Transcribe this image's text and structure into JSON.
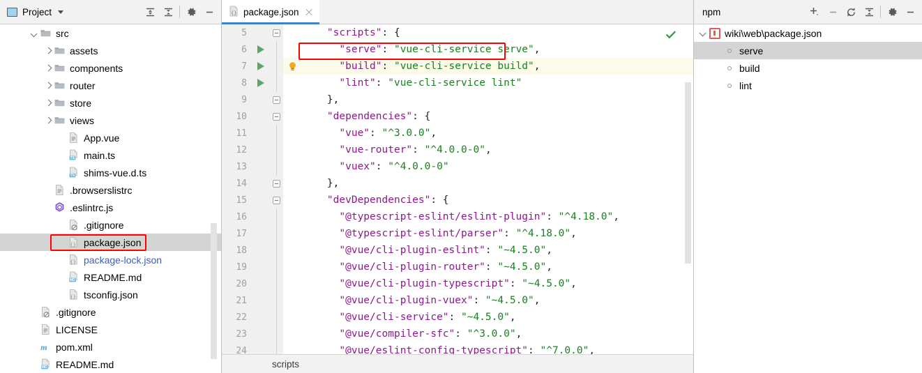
{
  "project_panel": {
    "title": "Project",
    "toolbar": [
      {
        "name": "expand-all-icon",
        "label": "Expand All"
      },
      {
        "name": "collapse-all-icon",
        "label": "Collapse All"
      },
      {
        "name": "gear-icon",
        "label": "Settings"
      },
      {
        "name": "minimize-icon",
        "label": "Hide"
      }
    ],
    "tree": [
      {
        "label": "src",
        "indent": 2,
        "arrow": "down",
        "icon": "folder",
        "selected": false,
        "link": false
      },
      {
        "label": "assets",
        "indent": 3,
        "arrow": "right",
        "icon": "folder",
        "selected": false,
        "link": false
      },
      {
        "label": "components",
        "indent": 3,
        "arrow": "right",
        "icon": "folder",
        "selected": false,
        "link": false
      },
      {
        "label": "router",
        "indent": 3,
        "arrow": "right",
        "icon": "folder",
        "selected": false,
        "link": false
      },
      {
        "label": "store",
        "indent": 3,
        "arrow": "right",
        "icon": "folder",
        "selected": false,
        "link": false
      },
      {
        "label": "views",
        "indent": 3,
        "arrow": "right",
        "icon": "folder",
        "selected": false,
        "link": false
      },
      {
        "label": "App.vue",
        "indent": 4,
        "arrow": "none",
        "icon": "file",
        "selected": false,
        "link": false
      },
      {
        "label": "main.ts",
        "indent": 4,
        "arrow": "none",
        "icon": "file-ts",
        "selected": false,
        "link": false
      },
      {
        "label": "shims-vue.d.ts",
        "indent": 4,
        "arrow": "none",
        "icon": "file-ts",
        "selected": false,
        "link": false
      },
      {
        "label": ".browserslistrc",
        "indent": 3,
        "arrow": "none",
        "icon": "file",
        "selected": false,
        "link": false
      },
      {
        "label": ".eslintrc.js",
        "indent": 3,
        "arrow": "none",
        "icon": "eslint",
        "selected": false,
        "link": false
      },
      {
        "label": ".gitignore",
        "indent": 4,
        "arrow": "none",
        "icon": "file-git",
        "selected": false,
        "link": false
      },
      {
        "label": "package.json",
        "indent": 4,
        "arrow": "none",
        "icon": "file-json",
        "selected": true,
        "link": false
      },
      {
        "label": "package-lock.json",
        "indent": 4,
        "arrow": "none",
        "icon": "file-json",
        "selected": false,
        "link": true
      },
      {
        "label": "README.md",
        "indent": 4,
        "arrow": "none",
        "icon": "file-md",
        "selected": false,
        "link": false
      },
      {
        "label": "tsconfig.json",
        "indent": 4,
        "arrow": "none",
        "icon": "file-json",
        "selected": false,
        "link": false
      },
      {
        "label": ".gitignore",
        "indent": 2,
        "arrow": "none",
        "icon": "file-git",
        "selected": false,
        "link": false
      },
      {
        "label": "LICENSE",
        "indent": 2,
        "arrow": "none",
        "icon": "file",
        "selected": false,
        "link": false
      },
      {
        "label": "pom.xml",
        "indent": 2,
        "arrow": "none",
        "icon": "maven",
        "selected": false,
        "link": false
      },
      {
        "label": "README.md",
        "indent": 2,
        "arrow": "none",
        "icon": "file-md",
        "selected": false,
        "link": false
      }
    ],
    "highlight_row_index": 12
  },
  "editor": {
    "tab": {
      "label": "package.json",
      "icon": "json-file-icon",
      "active": true
    },
    "breadcrumb": "scripts",
    "status_icon": "inspection-ok-check",
    "lines": [
      {
        "num": "5",
        "fold": "minus",
        "run": false,
        "bulb": false,
        "caret": false,
        "tokens": [
          {
            "t": "    ",
            "c": "p"
          },
          {
            "t": "\"scripts\"",
            "c": "k"
          },
          {
            "t": ": {",
            "c": "p"
          }
        ]
      },
      {
        "num": "6",
        "fold": "line",
        "run": true,
        "bulb": false,
        "caret": false,
        "tokens": [
          {
            "t": "      ",
            "c": "p"
          },
          {
            "t": "\"serve\"",
            "c": "k"
          },
          {
            "t": ": ",
            "c": "p"
          },
          {
            "t": "\"vue-cli-service serve\"",
            "c": "s"
          },
          {
            "t": ",",
            "c": "p"
          }
        ]
      },
      {
        "num": "7",
        "fold": "line",
        "run": true,
        "bulb": true,
        "caret": true,
        "tokens": [
          {
            "t": "      ",
            "c": "p"
          },
          {
            "t": "\"build\"",
            "c": "k"
          },
          {
            "t": ": ",
            "c": "p"
          },
          {
            "t": "\"vue-cli-service build\"",
            "c": "s"
          },
          {
            "t": ",",
            "c": "p"
          }
        ]
      },
      {
        "num": "8",
        "fold": "line",
        "run": true,
        "bulb": false,
        "caret": false,
        "tokens": [
          {
            "t": "      ",
            "c": "p"
          },
          {
            "t": "\"lint\"",
            "c": "k"
          },
          {
            "t": ": ",
            "c": "p"
          },
          {
            "t": "\"vue-cli-service lint\"",
            "c": "s"
          }
        ]
      },
      {
        "num": "9",
        "fold": "minus",
        "run": false,
        "bulb": false,
        "caret": false,
        "tokens": [
          {
            "t": "    },",
            "c": "p"
          }
        ]
      },
      {
        "num": "10",
        "fold": "minus",
        "run": false,
        "bulb": false,
        "caret": false,
        "tokens": [
          {
            "t": "    ",
            "c": "p"
          },
          {
            "t": "\"dependencies\"",
            "c": "k"
          },
          {
            "t": ": {",
            "c": "p"
          }
        ]
      },
      {
        "num": "11",
        "fold": "line",
        "run": false,
        "bulb": false,
        "caret": false,
        "tokens": [
          {
            "t": "      ",
            "c": "p"
          },
          {
            "t": "\"vue\"",
            "c": "k"
          },
          {
            "t": ": ",
            "c": "p"
          },
          {
            "t": "\"^3.0.0\"",
            "c": "s"
          },
          {
            "t": ",",
            "c": "p"
          }
        ]
      },
      {
        "num": "12",
        "fold": "line",
        "run": false,
        "bulb": false,
        "caret": false,
        "tokens": [
          {
            "t": "      ",
            "c": "p"
          },
          {
            "t": "\"vue-router\"",
            "c": "k"
          },
          {
            "t": ": ",
            "c": "p"
          },
          {
            "t": "\"^4.0.0-0\"",
            "c": "s"
          },
          {
            "t": ",",
            "c": "p"
          }
        ]
      },
      {
        "num": "13",
        "fold": "line",
        "run": false,
        "bulb": false,
        "caret": false,
        "tokens": [
          {
            "t": "      ",
            "c": "p"
          },
          {
            "t": "\"vuex\"",
            "c": "k"
          },
          {
            "t": ": ",
            "c": "p"
          },
          {
            "t": "\"^4.0.0-0\"",
            "c": "s"
          }
        ]
      },
      {
        "num": "14",
        "fold": "minus",
        "run": false,
        "bulb": false,
        "caret": false,
        "tokens": [
          {
            "t": "    },",
            "c": "p"
          }
        ]
      },
      {
        "num": "15",
        "fold": "minus",
        "run": false,
        "bulb": false,
        "caret": false,
        "tokens": [
          {
            "t": "    ",
            "c": "p"
          },
          {
            "t": "\"devDependencies\"",
            "c": "k"
          },
          {
            "t": ": {",
            "c": "p"
          }
        ]
      },
      {
        "num": "16",
        "fold": "line",
        "run": false,
        "bulb": false,
        "caret": false,
        "tokens": [
          {
            "t": "      ",
            "c": "p"
          },
          {
            "t": "\"@typescript-eslint/eslint-plugin\"",
            "c": "k"
          },
          {
            "t": ": ",
            "c": "p"
          },
          {
            "t": "\"^4.18.0\"",
            "c": "s"
          },
          {
            "t": ",",
            "c": "p"
          }
        ]
      },
      {
        "num": "17",
        "fold": "line",
        "run": false,
        "bulb": false,
        "caret": false,
        "tokens": [
          {
            "t": "      ",
            "c": "p"
          },
          {
            "t": "\"@typescript-eslint/parser\"",
            "c": "k"
          },
          {
            "t": ": ",
            "c": "p"
          },
          {
            "t": "\"^4.18.0\"",
            "c": "s"
          },
          {
            "t": ",",
            "c": "p"
          }
        ]
      },
      {
        "num": "18",
        "fold": "line",
        "run": false,
        "bulb": false,
        "caret": false,
        "tokens": [
          {
            "t": "      ",
            "c": "p"
          },
          {
            "t": "\"@vue/cli-plugin-eslint\"",
            "c": "k"
          },
          {
            "t": ": ",
            "c": "p"
          },
          {
            "t": "\"~4.5.0\"",
            "c": "s"
          },
          {
            "t": ",",
            "c": "p"
          }
        ]
      },
      {
        "num": "19",
        "fold": "line",
        "run": false,
        "bulb": false,
        "caret": false,
        "tokens": [
          {
            "t": "      ",
            "c": "p"
          },
          {
            "t": "\"@vue/cli-plugin-router\"",
            "c": "k"
          },
          {
            "t": ": ",
            "c": "p"
          },
          {
            "t": "\"~4.5.0\"",
            "c": "s"
          },
          {
            "t": ",",
            "c": "p"
          }
        ]
      },
      {
        "num": "20",
        "fold": "line",
        "run": false,
        "bulb": false,
        "caret": false,
        "tokens": [
          {
            "t": "      ",
            "c": "p"
          },
          {
            "t": "\"@vue/cli-plugin-typescript\"",
            "c": "k"
          },
          {
            "t": ": ",
            "c": "p"
          },
          {
            "t": "\"~4.5.0\"",
            "c": "s"
          },
          {
            "t": ",",
            "c": "p"
          }
        ]
      },
      {
        "num": "21",
        "fold": "line",
        "run": false,
        "bulb": false,
        "caret": false,
        "tokens": [
          {
            "t": "      ",
            "c": "p"
          },
          {
            "t": "\"@vue/cli-plugin-vuex\"",
            "c": "k"
          },
          {
            "t": ": ",
            "c": "p"
          },
          {
            "t": "\"~4.5.0\"",
            "c": "s"
          },
          {
            "t": ",",
            "c": "p"
          }
        ]
      },
      {
        "num": "22",
        "fold": "line",
        "run": false,
        "bulb": false,
        "caret": false,
        "tokens": [
          {
            "t": "      ",
            "c": "p"
          },
          {
            "t": "\"@vue/cli-service\"",
            "c": "k"
          },
          {
            "t": ": ",
            "c": "p"
          },
          {
            "t": "\"~4.5.0\"",
            "c": "s"
          },
          {
            "t": ",",
            "c": "p"
          }
        ]
      },
      {
        "num": "23",
        "fold": "line",
        "run": false,
        "bulb": false,
        "caret": false,
        "tokens": [
          {
            "t": "      ",
            "c": "p"
          },
          {
            "t": "\"@vue/compiler-sfc\"",
            "c": "k"
          },
          {
            "t": ": ",
            "c": "p"
          },
          {
            "t": "\"^3.0.0\"",
            "c": "s"
          },
          {
            "t": ",",
            "c": "p"
          }
        ]
      },
      {
        "num": "24",
        "fold": "line",
        "run": false,
        "bulb": false,
        "caret": false,
        "tokens": [
          {
            "t": "      ",
            "c": "p"
          },
          {
            "t": "\"@vue/eslint-config-typescript\"",
            "c": "k"
          },
          {
            "t": ": ",
            "c": "p"
          },
          {
            "t": "\"^7.0.0\"",
            "c": "s"
          },
          {
            "t": ",",
            "c": "p"
          }
        ]
      }
    ],
    "highlight_line_index": 1
  },
  "npm_panel": {
    "title": "npm",
    "toolbar": [
      {
        "name": "add-icon",
        "label": "Add"
      },
      {
        "name": "remove-icon",
        "label": "Remove"
      },
      {
        "name": "refresh-icon",
        "label": "Reload scripts"
      },
      {
        "name": "collapse-all-icon",
        "label": "Collapse All"
      },
      {
        "name": "gear-icon",
        "label": "Settings"
      },
      {
        "name": "minimize-icon",
        "label": "Hide"
      }
    ],
    "root": {
      "label": "wiki\\web\\package.json",
      "expanded": true
    },
    "scripts": [
      {
        "label": "serve",
        "selected": true
      },
      {
        "label": "build",
        "selected": false
      },
      {
        "label": "lint",
        "selected": false
      }
    ]
  },
  "colors": {
    "accent": "#4083c9",
    "highlight_box": "#ff0000",
    "run_green": "#59a869",
    "string_green": "#1a8020",
    "key_purple": "#8c1a8c",
    "caret_line": "#fcfae8",
    "selection_gray": "#d4d4d4"
  }
}
